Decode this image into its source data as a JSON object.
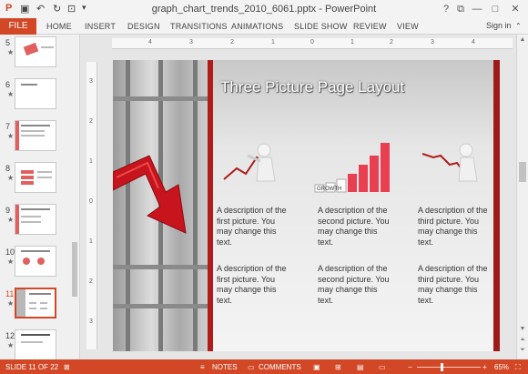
{
  "window": {
    "title": "graph_chart_trends_2010_6061.pptx - PowerPoint",
    "controls": [
      "?",
      "restore",
      "—",
      "□",
      "✕"
    ]
  },
  "ribbon": {
    "file_label": "FILE",
    "tabs": [
      "HOME",
      "INSERT",
      "DESIGN",
      "TRANSITIONS",
      "ANIMATIONS",
      "SLIDE SHOW",
      "REVIEW",
      "VIEW"
    ],
    "signin_label": "Sign in"
  },
  "thumbnails": [
    {
      "num": "5",
      "star": "★"
    },
    {
      "num": "6",
      "star": "★"
    },
    {
      "num": "7",
      "star": "★"
    },
    {
      "num": "8",
      "star": "★"
    },
    {
      "num": "9",
      "star": "★"
    },
    {
      "num": "10",
      "star": "★"
    },
    {
      "num": "11",
      "star": "★"
    },
    {
      "num": "12",
      "star": "★"
    }
  ],
  "ruler": {
    "h_ticks": [
      "4",
      "3",
      "2",
      "1",
      "0",
      "1",
      "2",
      "3",
      "4"
    ],
    "v_ticks": [
      "3",
      "2",
      "1",
      "0",
      "1",
      "2",
      "3"
    ]
  },
  "slide": {
    "title": "Three Picture Page Layout",
    "growth_word": "GROWTH",
    "desc_row1": [
      "A description of the first picture. You may change this text.",
      "A description of the second picture. You may change this text.",
      "A description of the third picture. You may change this text."
    ],
    "desc_row2": [
      "A description of the first picture. You may change this text.",
      "A description of the second picture. You may change this text.",
      "A description of the third picture. You may change this text."
    ]
  },
  "status": {
    "slide_info": "SLIDE 11 OF 22",
    "notes_label": "NOTES",
    "comments_label": "COMMENTS",
    "zoom": "65%",
    "zoom_fraction": 0.65
  },
  "colors": {
    "accent": "#d24726",
    "slide_red": "#b01c1c"
  }
}
